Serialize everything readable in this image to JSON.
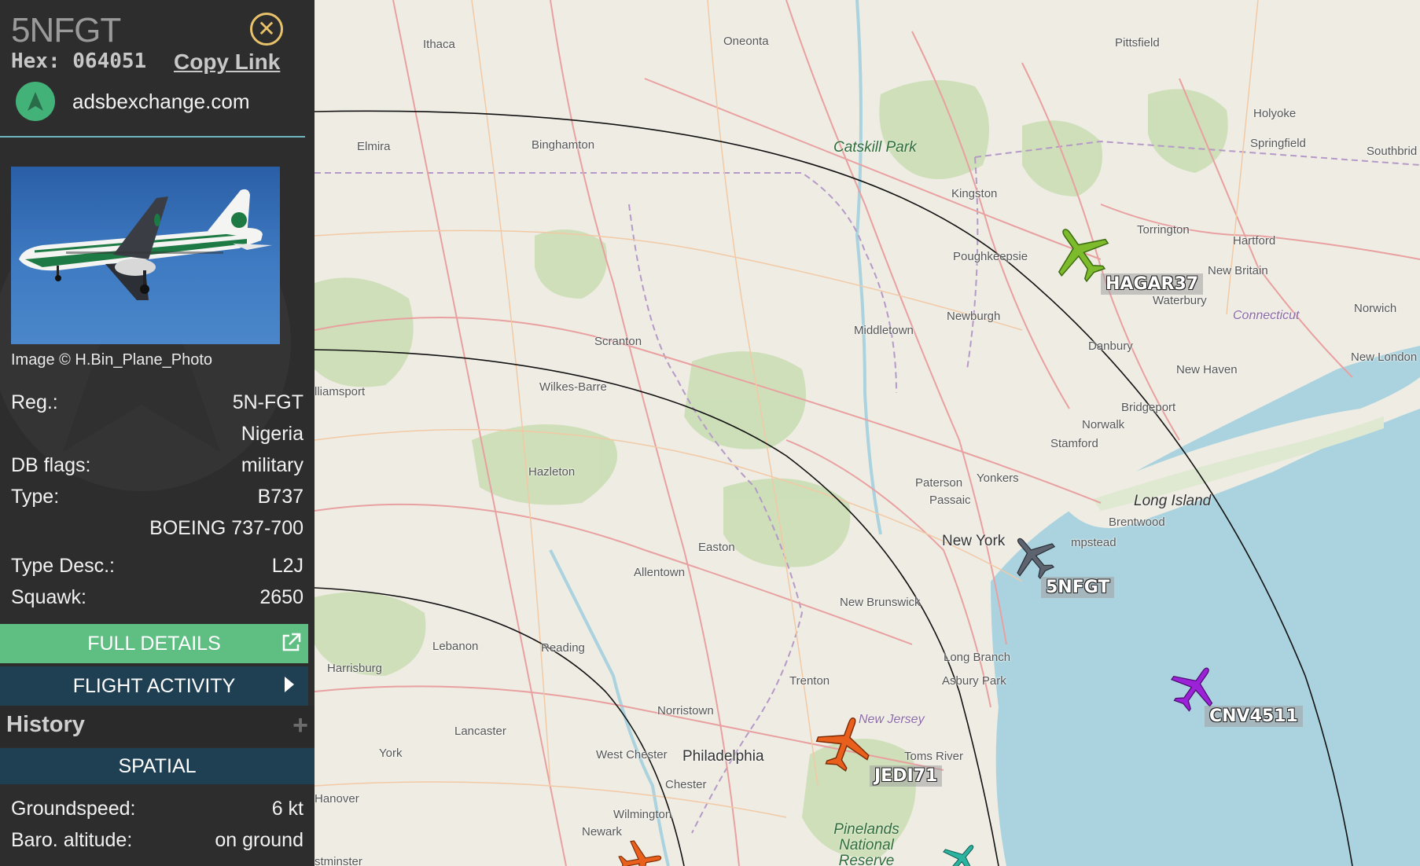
{
  "sidebar": {
    "title": "5NFGT",
    "hex_line": "Hex: 064051",
    "copy_link": "Copy Link",
    "source": "adsbexchange.com",
    "photo_credit": "Image © H.Bin_Plane_Photo",
    "details": [
      {
        "key": "Reg.:",
        "value": "5N-FGT"
      },
      {
        "key": "",
        "value": "Nigeria"
      },
      {
        "key": "DB flags:",
        "value": "military"
      },
      {
        "key": "Type:",
        "value": "B737"
      },
      {
        "key": "",
        "value": "BOEING 737-700"
      },
      {
        "key": "Type Desc.:",
        "value": "L2J"
      },
      {
        "key": "Squawk:",
        "value": "2650"
      }
    ],
    "full_details": "FULL DETAILS",
    "flight_activity": "FLIGHT ACTIVITY",
    "history": "History",
    "spatial": "SPATIAL",
    "spatial_details": [
      {
        "key": "Groundspeed:",
        "value": "6 kt"
      },
      {
        "key": "Baro. altitude:",
        "value": "on ground"
      }
    ]
  },
  "map": {
    "cities": [
      "Ithaca",
      "Oneonta",
      "Pittsfield",
      "Holyoke",
      "Springfield",
      "Southbrid",
      "Elmira",
      "Binghamton",
      "Kingston",
      "Torrington",
      "Hartford",
      "Poughkeepsie",
      "New Britain",
      "Waterbury",
      "Norwich",
      "Middletown",
      "Newburgh",
      "Danbury",
      "New Haven",
      "New London",
      "Scranton",
      "Wilkes-Barre",
      "Bridgeport",
      "Norwalk",
      "Stamford",
      "Hazleton",
      "Paterson",
      "Yonkers",
      "Passaic",
      "Brentwood",
      "New York",
      "mpstead",
      "Easton",
      "Allentown",
      "New Brunswick",
      "Lebanon",
      "Reading",
      "Harrisburg",
      "Long Branch",
      "Asbury Park",
      "Trenton",
      "Norristown",
      "Lancaster",
      "York",
      "West Chester",
      "Philadelphia",
      "Toms River",
      "Chester",
      "Hanover",
      "Wilmington",
      "Newark",
      "lliamsport",
      "stminster"
    ],
    "regions": {
      "catskill": "Catskill Park",
      "connecticut": "Connecticut",
      "long_island": "Long Island",
      "new_jersey": "New Jersey",
      "pinelands": "Pinelands National Reserve"
    },
    "aircraft": [
      {
        "callsign": "HAGAR37",
        "color": "#7dbb2c"
      },
      {
        "callsign": "5NFGT",
        "color": "#5d6470"
      },
      {
        "callsign": "CNV4511",
        "color": "#9b22d6"
      },
      {
        "callsign": "JEDI71",
        "color": "#e8601c"
      }
    ]
  }
}
